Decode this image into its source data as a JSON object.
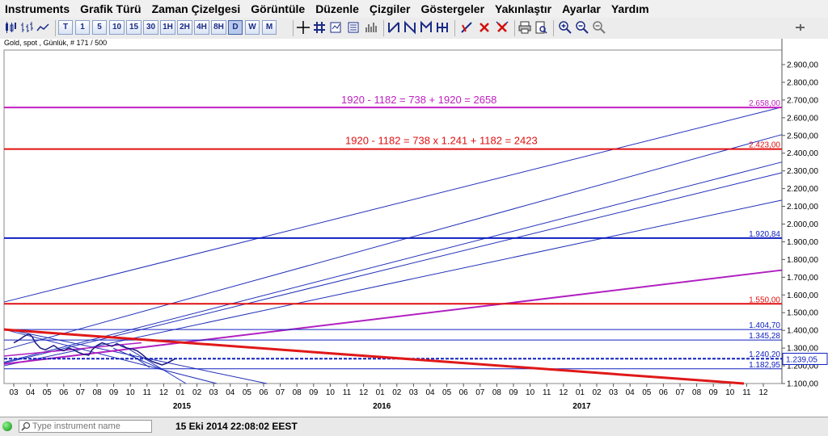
{
  "menu": [
    "Instruments",
    "Grafik Türü",
    "Zaman Çizelgesi",
    "Görüntüle",
    "Düzenle",
    "Çizgiler",
    "Göstergeler",
    "Yakınlaştır",
    "Ayarlar",
    "Yardım"
  ],
  "toolbar": {
    "timeframes": [
      "T",
      "1",
      "5",
      "10",
      "15",
      "30",
      "1H",
      "2H",
      "4H",
      "8H",
      "D",
      "W",
      "M"
    ],
    "active_timeframe": "D"
  },
  "chart_info": "Gold, spot , Günlük, # 171 / 500",
  "chart_data": {
    "type": "line",
    "instrument": "Gold, spot",
    "y_ticks": [
      "2.900,00",
      "2.800,00",
      "2.700,00",
      "2.600,00",
      "2.500,00",
      "2.400,00",
      "2.300,00",
      "2.200,00",
      "2.100,00",
      "2.000,00",
      "1.900,00",
      "1.800,00",
      "1.700,00",
      "1.600,00",
      "1.500,00",
      "1.400,00",
      "1.300,00",
      "1.200,00",
      "1.100,00"
    ],
    "ylim": [
      1100,
      2900
    ],
    "x_month_ticks": [
      "03",
      "04",
      "05",
      "06",
      "07",
      "08",
      "09",
      "10",
      "11",
      "12",
      "01",
      "02",
      "03",
      "04",
      "05",
      "06",
      "07",
      "08",
      "09",
      "10",
      "11",
      "12",
      "01",
      "02",
      "03",
      "04",
      "05",
      "06",
      "07",
      "08",
      "09",
      "10",
      "11",
      "12",
      "01",
      "02",
      "03",
      "04",
      "05",
      "06",
      "07",
      "08",
      "09",
      "10",
      "11",
      "12"
    ],
    "x_year_labels": [
      {
        "label": "2015",
        "month_index": 10
      },
      {
        "label": "2016",
        "month_index": 22
      },
      {
        "label": "2017",
        "month_index": 34
      }
    ],
    "horizontal_levels": [
      {
        "value": 2658,
        "label": "2.658,00",
        "color": "#c020c0"
      },
      {
        "value": 2423,
        "label": "2.423,00",
        "color": "#e01010"
      },
      {
        "value": 1920.84,
        "label": "1.920,84",
        "color": "#1020c0"
      },
      {
        "value": 1550,
        "label": "1.550,00",
        "color": "#e01010"
      },
      {
        "value": 1404.7,
        "label": "1.404,70",
        "color": "#1020c0"
      },
      {
        "value": 1345.28,
        "label": "1.345,28",
        "color": "#1020c0"
      },
      {
        "value": 1240.2,
        "label": "1.240,20",
        "color": "#1020c0"
      },
      {
        "value": 1182.95,
        "label": "1.182,95",
        "color": "#1020c0"
      }
    ],
    "current_price": "1.239,05",
    "annotations": [
      {
        "text": "1920 - 1182 = 738 + 1920 = 2658",
        "color": "#c020c0"
      },
      {
        "text": "1920 - 1182 = 738 x 1.241 + 1182 = 2423",
        "color": "#e01010"
      }
    ],
    "price_series": [
      [
        0,
        1330
      ],
      [
        0.3,
        1345
      ],
      [
        0.6,
        1365
      ],
      [
        0.9,
        1380
      ],
      [
        1.1,
        1365
      ],
      [
        1.3,
        1330
      ],
      [
        1.6,
        1300
      ],
      [
        1.9,
        1290
      ],
      [
        2.1,
        1300
      ],
      [
        2.4,
        1315
      ],
      [
        2.7,
        1295
      ],
      [
        3.0,
        1285
      ],
      [
        3.3,
        1300
      ],
      [
        3.6,
        1290
      ],
      [
        3.9,
        1275
      ],
      [
        4.2,
        1265
      ],
      [
        4.5,
        1260
      ],
      [
        4.7,
        1290
      ],
      [
        5.0,
        1315
      ],
      [
        5.3,
        1330
      ],
      [
        5.6,
        1320
      ],
      [
        5.9,
        1310
      ],
      [
        6.2,
        1325
      ],
      [
        6.5,
        1310
      ],
      [
        6.8,
        1300
      ],
      [
        7.1,
        1295
      ],
      [
        7.4,
        1285
      ],
      [
        7.7,
        1265
      ],
      [
        8.0,
        1240
      ],
      [
        8.3,
        1225
      ],
      [
        8.6,
        1215
      ],
      [
        8.9,
        1205
      ],
      [
        9.2,
        1215
      ],
      [
        9.5,
        1230
      ],
      [
        9.7,
        1240
      ]
    ]
  },
  "status": {
    "search_placeholder": "Type instrument name",
    "timestamp": "15 Eki 2014 22:08:02 EEST"
  }
}
